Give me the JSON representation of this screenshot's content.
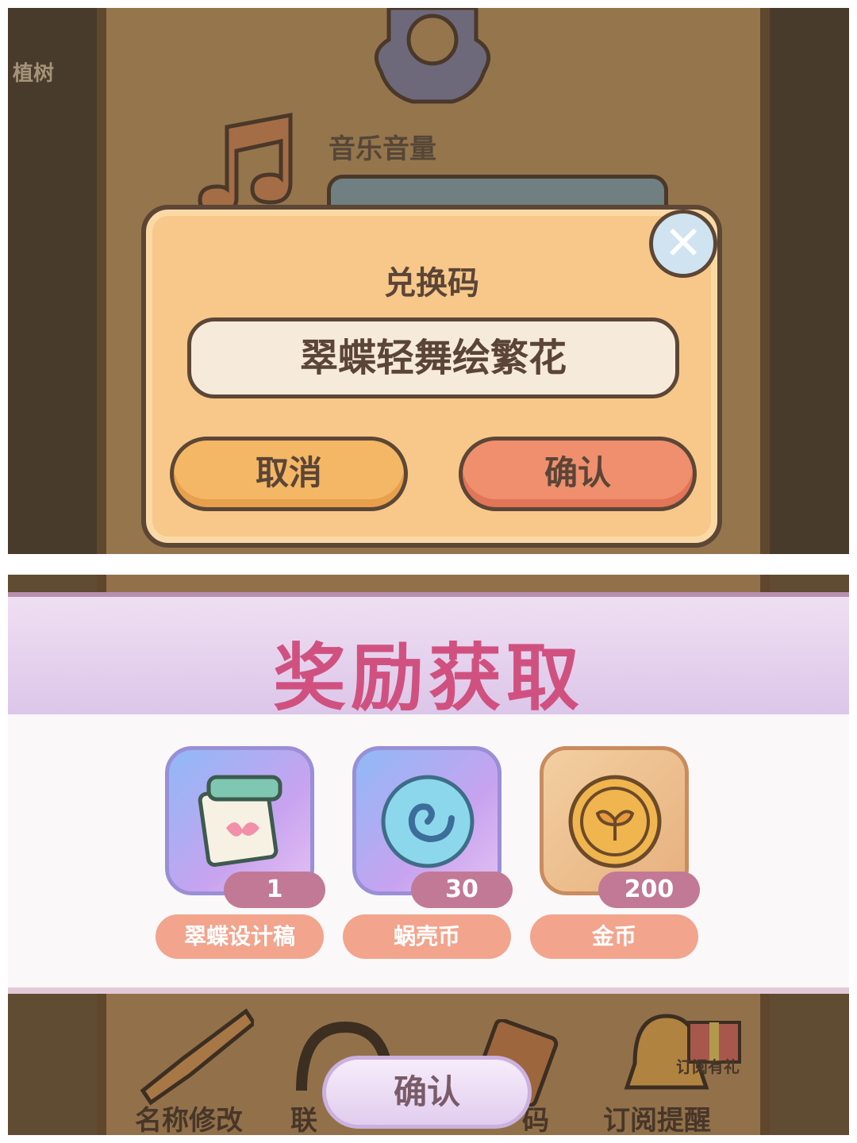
{
  "top": {
    "side_label": "植树",
    "music_label": "音乐音量",
    "dialog": {
      "title": "兑换码",
      "code_value": "翠蝶轻舞绘繁花",
      "cancel_label": "取消",
      "confirm_label": "确认"
    }
  },
  "bottom": {
    "banner_title": "奖励获取",
    "rewards": [
      {
        "name": "翠蝶设计稿",
        "count": "1",
        "icon": "design-draft-icon"
      },
      {
        "name": "蜗壳币",
        "count": "30",
        "icon": "snail-shell-coin-icon"
      },
      {
        "name": "金币",
        "count": "200",
        "icon": "gold-coin-icon"
      }
    ],
    "menu": {
      "rename": "名称修改",
      "link_partial": "联",
      "code_partial": "码",
      "subscribe": "订阅提醒",
      "subscribe_gift": "订阅有礼"
    },
    "confirm_label": "确认"
  },
  "colors": {
    "panel_bg": "#f7c88a",
    "cancel_button": "#f3b765",
    "confirm_button": "#ef8f6e",
    "banner_title": "#d0517f",
    "count_pill": "#c27996",
    "name_pill": "#f2a48d"
  }
}
